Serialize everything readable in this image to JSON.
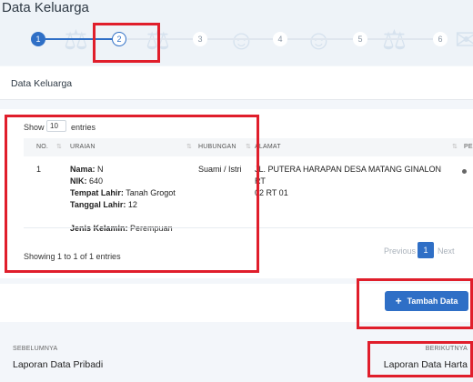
{
  "page": {
    "title": "Data Keluarga"
  },
  "stepper": {
    "steps": [
      {
        "label": "1",
        "state": "done"
      },
      {
        "label": "2",
        "state": "current"
      },
      {
        "label": "3",
        "state": "todo"
      },
      {
        "label": "4",
        "state": "todo"
      },
      {
        "label": "5",
        "state": "todo"
      },
      {
        "label": "6",
        "state": "todo"
      }
    ]
  },
  "section": {
    "title": "Data Keluarga"
  },
  "table_controls": {
    "show_label": "Show",
    "entries_value": "10",
    "entries_label": "entries"
  },
  "table": {
    "headers": [
      "NO.",
      "URAIAN",
      "HUBUNGAN",
      "ALAMAT",
      "PE"
    ],
    "rows": [
      {
        "no": "1",
        "uraian": {
          "nama_label": "Nama:",
          "nama_value": "N",
          "nik_label": "NIK:",
          "nik_value": "640",
          "tempat_label": "Tempat Lahir:",
          "tempat_value": "Tanah Grogot",
          "tanggal_label": "Tanggal Lahir:",
          "tanggal_value": "12",
          "jk_label": "Jenis Kelamin:",
          "jk_value": "Perempuan"
        },
        "hubungan": "Suami / Istri",
        "alamat_line1": "JL. PUTERA HARAPAN DESA MATANG GINALON RT",
        "alamat_line2": "02 RT 01"
      }
    ],
    "info": "Showing 1 to 1 of 1 entries"
  },
  "pagination": {
    "previous": "Previous",
    "page": "1",
    "next": "Next"
  },
  "actions": {
    "add_label": "Tambah Data"
  },
  "footer": {
    "prev_caption": "SEBELUMNYA",
    "prev_link": "Laporan Data Pribadi",
    "next_caption": "BERIKUTNYA",
    "next_link": "Laporan Data Harta"
  },
  "colors": {
    "accent": "#2f6fc6",
    "highlight": "#e01e2b"
  }
}
